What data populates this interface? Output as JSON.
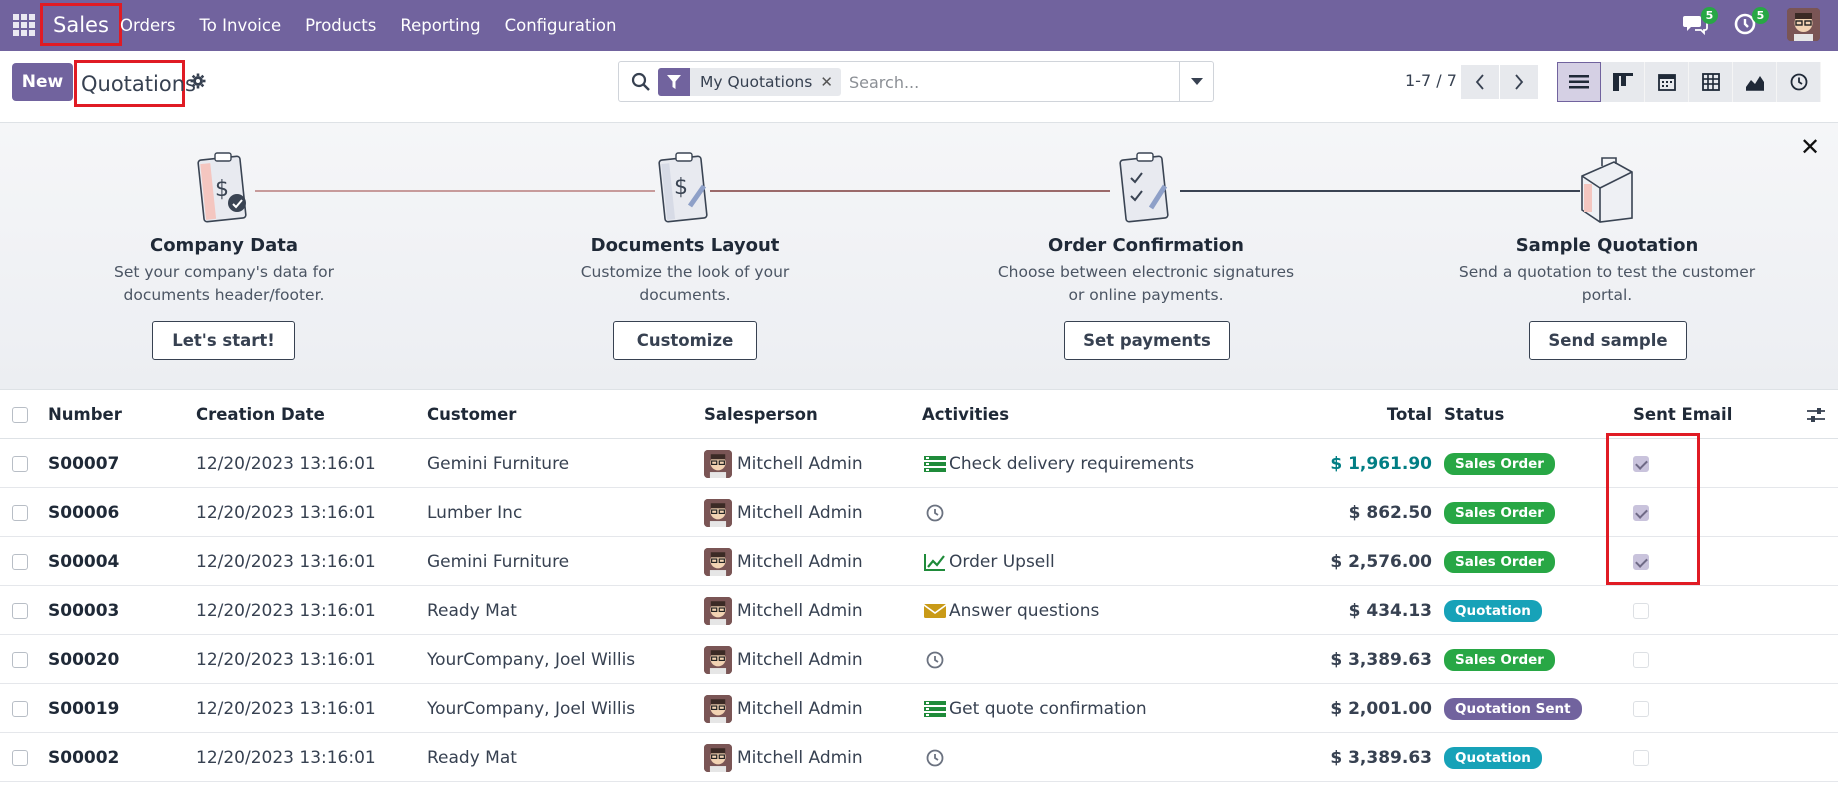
{
  "navbar": {
    "app_name": "Sales",
    "menu": [
      "Orders",
      "To Invoice",
      "Products",
      "Reporting",
      "Configuration"
    ],
    "messages_count": "5",
    "activities_count": "5",
    "bg_color": "#71639e"
  },
  "control_panel": {
    "new_label": "New",
    "title": "Quotations",
    "search": {
      "facet_label": "My Quotations",
      "placeholder": "Search..."
    },
    "pager_value": "1-7 / 7",
    "views": [
      "list-view-icon",
      "kanban-view-icon",
      "calendar-view-icon",
      "pivot-view-icon",
      "graph-view-icon",
      "activity-view-icon"
    ]
  },
  "onboarding": {
    "steps": [
      {
        "title": "Company Data",
        "description": "Set your company's data for documents header/footer.",
        "button": "Let's start!"
      },
      {
        "title": "Documents Layout",
        "description": "Customize the look of your documents.",
        "button": "Customize"
      },
      {
        "title": "Order Confirmation",
        "description": "Choose between electronic signatures or online payments.",
        "button": "Set payments"
      },
      {
        "title": "Sample Quotation",
        "description": "Send a quotation to test the customer portal.",
        "button": "Send sample"
      }
    ]
  },
  "list": {
    "columns": {
      "number": "Number",
      "creation_date": "Creation Date",
      "customer": "Customer",
      "salesperson": "Salesperson",
      "activities": "Activities",
      "total": "Total",
      "status": "Status",
      "sent_email": "Sent Email"
    },
    "rows": [
      {
        "number": "S00007",
        "date": "12/20/2023 13:16:01",
        "customer": "Gemini Furniture",
        "salesperson": "Mitchell Admin",
        "activity_icon": "todo-list-icon",
        "activity": "Check delivery requirements",
        "total": "$ 1,961.90",
        "status": "Sales Order",
        "sent": true
      },
      {
        "number": "S00006",
        "date": "12/20/2023 13:16:01",
        "customer": "Lumber Inc",
        "salesperson": "Mitchell Admin",
        "activity_icon": "clock-icon",
        "activity": "",
        "total": "$ 862.50",
        "status": "Sales Order",
        "sent": true
      },
      {
        "number": "S00004",
        "date": "12/20/2023 13:16:01",
        "customer": "Gemini Furniture",
        "salesperson": "Mitchell Admin",
        "activity_icon": "upsell-chart-icon",
        "activity": "Order Upsell",
        "total": "$ 2,576.00",
        "status": "Sales Order",
        "sent": true
      },
      {
        "number": "S00003",
        "date": "12/20/2023 13:16:01",
        "customer": "Ready Mat",
        "salesperson": "Mitchell Admin",
        "activity_icon": "envelope-icon",
        "activity": "Answer questions",
        "total": "$ 434.13",
        "status": "Quotation",
        "sent": false
      },
      {
        "number": "S00020",
        "date": "12/20/2023 13:16:01",
        "customer": "YourCompany, Joel Willis",
        "salesperson": "Mitchell Admin",
        "activity_icon": "clock-icon",
        "activity": "",
        "total": "$ 3,389.63",
        "status": "Sales Order",
        "sent": false
      },
      {
        "number": "S00019",
        "date": "12/20/2023 13:16:01",
        "customer": "YourCompany, Joel Willis",
        "salesperson": "Mitchell Admin",
        "activity_icon": "todo-list-icon",
        "activity": "Get quote confirmation",
        "total": "$ 2,001.00",
        "status": "Quotation Sent",
        "sent": false
      },
      {
        "number": "S00002",
        "date": "12/20/2023 13:16:01",
        "customer": "Ready Mat",
        "salesperson": "Mitchell Admin",
        "activity_icon": "clock-icon",
        "activity": "",
        "total": "$ 3,389.63",
        "status": "Quotation",
        "sent": false
      }
    ]
  },
  "status_colors": {
    "Sales Order": "#28a745",
    "Quotation": "#17a2b8",
    "Quotation Sent": "#71639e"
  }
}
